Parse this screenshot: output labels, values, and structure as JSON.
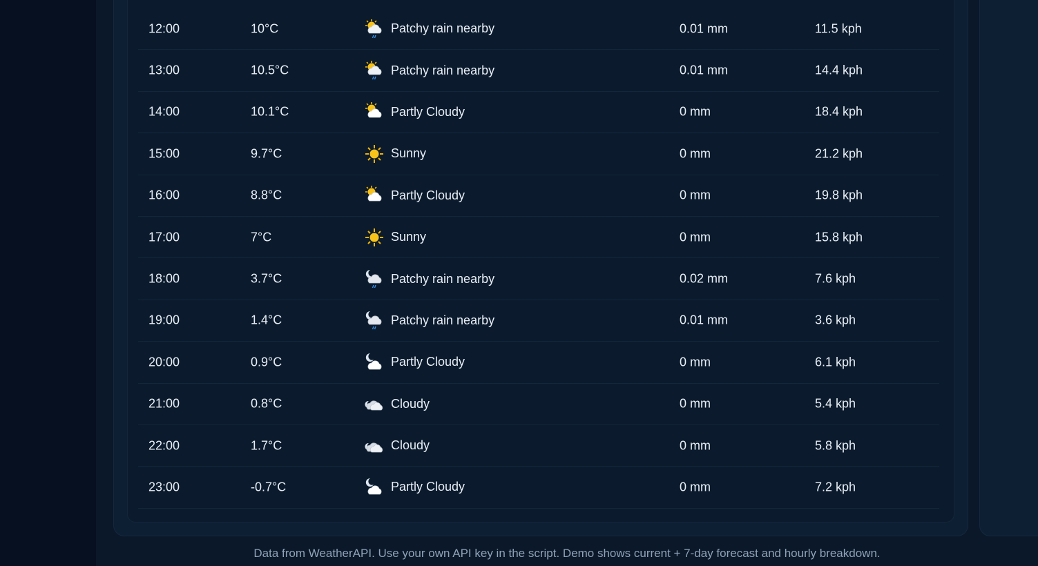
{
  "hourly": [
    {
      "time": "12:00",
      "temp": "10°C",
      "icon": "patchy-rain-day-icon",
      "condition": "Patchy rain nearby",
      "precip": "0.01 mm",
      "wind": "11.5 kph"
    },
    {
      "time": "13:00",
      "temp": "10.5°C",
      "icon": "patchy-rain-day-icon",
      "condition": "Patchy rain nearby",
      "precip": "0.01 mm",
      "wind": "14.4 kph"
    },
    {
      "time": "14:00",
      "temp": "10.1°C",
      "icon": "partly-cloudy-day-icon",
      "condition": "Partly Cloudy",
      "precip": "0 mm",
      "wind": "18.4 kph"
    },
    {
      "time": "15:00",
      "temp": "9.7°C",
      "icon": "sunny-icon",
      "condition": "Sunny",
      "precip": "0 mm",
      "wind": "21.2 kph"
    },
    {
      "time": "16:00",
      "temp": "8.8°C",
      "icon": "partly-cloudy-day-icon",
      "condition": "Partly Cloudy",
      "precip": "0 mm",
      "wind": "19.8 kph"
    },
    {
      "time": "17:00",
      "temp": "7°C",
      "icon": "sunny-icon",
      "condition": "Sunny",
      "precip": "0 mm",
      "wind": "15.8 kph"
    },
    {
      "time": "18:00",
      "temp": "3.7°C",
      "icon": "patchy-rain-night-icon",
      "condition": "Patchy rain nearby",
      "precip": "0.02 mm",
      "wind": "7.6 kph"
    },
    {
      "time": "19:00",
      "temp": "1.4°C",
      "icon": "patchy-rain-night-icon",
      "condition": "Patchy rain nearby",
      "precip": "0.01 mm",
      "wind": "3.6 kph"
    },
    {
      "time": "20:00",
      "temp": "0.9°C",
      "icon": "partly-cloudy-night-icon",
      "condition": "Partly Cloudy",
      "precip": "0 mm",
      "wind": "6.1 kph"
    },
    {
      "time": "21:00",
      "temp": "0.8°C",
      "icon": "cloudy-night-icon",
      "condition": "Cloudy",
      "precip": "0 mm",
      "wind": "5.4 kph"
    },
    {
      "time": "22:00",
      "temp": "1.7°C",
      "icon": "cloudy-night-icon",
      "condition": "Cloudy",
      "precip": "0 mm",
      "wind": "5.8 kph"
    },
    {
      "time": "23:00",
      "temp": "-0.7°C",
      "icon": "partly-cloudy-night-icon",
      "condition": "Partly Cloudy",
      "precip": "0 mm",
      "wind": "7.2 kph"
    }
  ],
  "footer": {
    "note": "Data from WeatherAPI. Use your own API key in the script. Demo shows current + 7-day forecast and hourly breakdown."
  }
}
